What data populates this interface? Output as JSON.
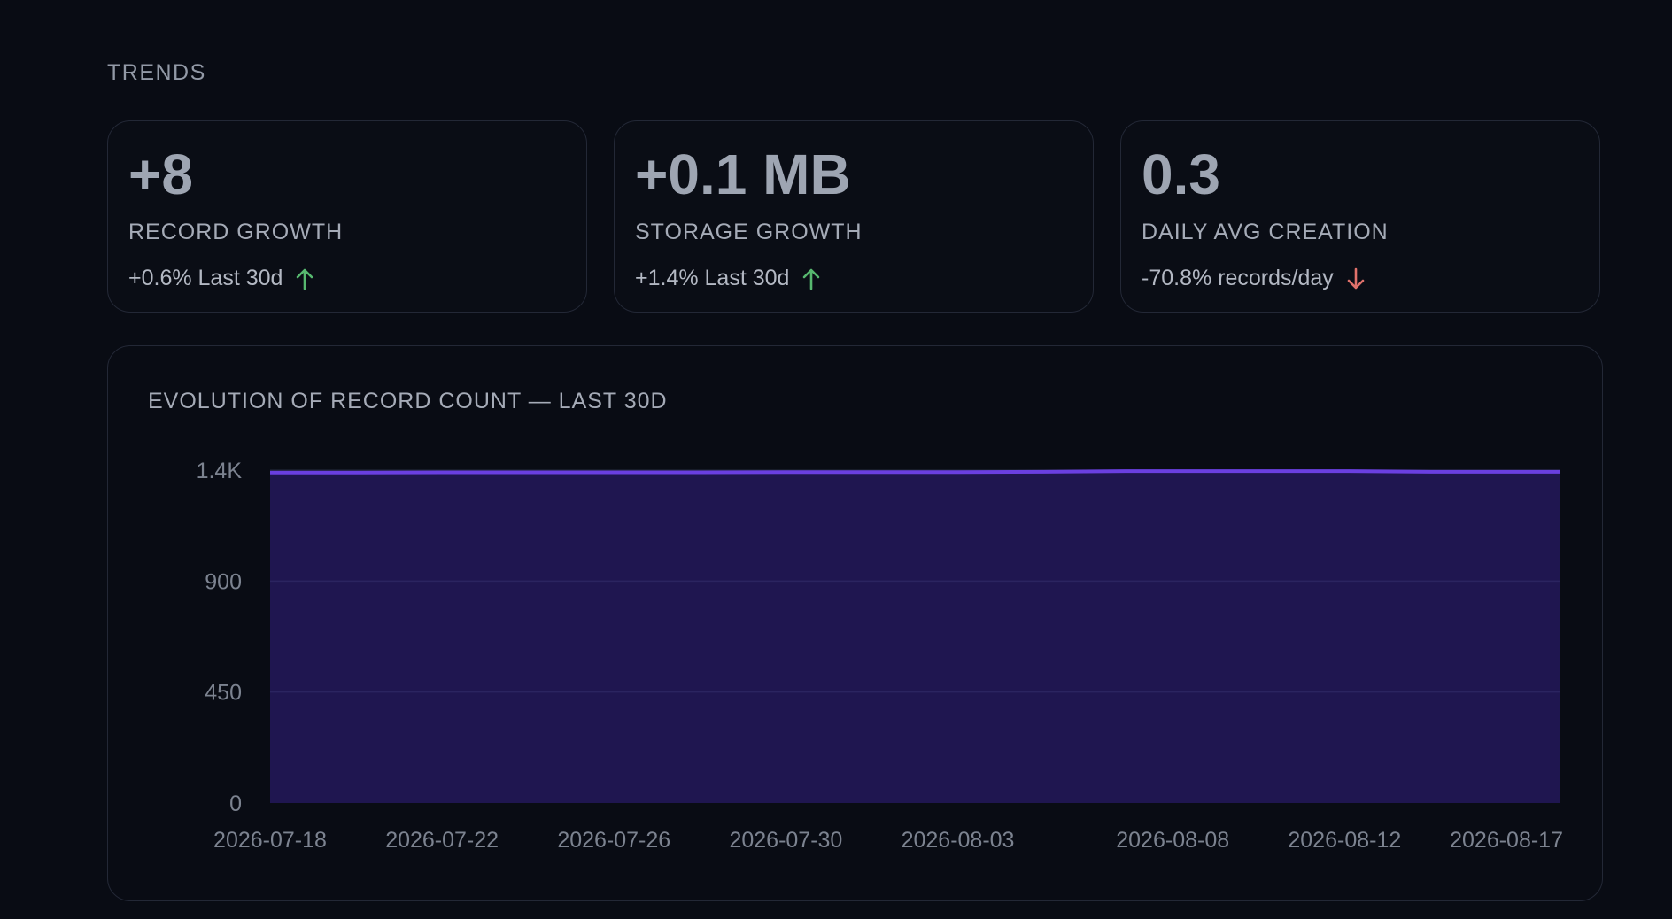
{
  "section_title": "TRENDS",
  "cards": [
    {
      "value": "+8",
      "label": "RECORD GROWTH",
      "delta": "+0.6% Last 30d",
      "trend": "up",
      "trend_color": "#57b86f"
    },
    {
      "value": "+0.1 MB",
      "label": "STORAGE GROWTH",
      "delta": "+1.4% Last 30d",
      "trend": "up",
      "trend_color": "#57b86f"
    },
    {
      "value": "0.3",
      "label": "DAILY AVG CREATION",
      "delta": "-70.8% records/day",
      "trend": "down",
      "trend_color": "#e0716b"
    }
  ],
  "chart": {
    "title": "EVOLUTION OF RECORD COUNT — LAST 30D"
  },
  "chart_data": {
    "type": "area",
    "title": "EVOLUTION OF RECORD COUNT — LAST 30D",
    "xlabel": "",
    "ylabel": "",
    "x_tick_labels": [
      "2026-07-18",
      "2026-07-22",
      "2026-07-26",
      "2026-07-30",
      "2026-08-03",
      "2026-08-08",
      "2026-08-12",
      "2026-08-17"
    ],
    "y_tick_values": [
      0,
      450,
      900,
      1350
    ],
    "y_tick_labels": [
      "0",
      "450",
      "900",
      "1.4K"
    ],
    "ylim": [
      0,
      1350
    ],
    "grid": "horizontal",
    "line_color": "#6a3fe0",
    "fill_color": "#1f1650",
    "x": [
      "2026-07-18",
      "2026-07-20",
      "2026-07-22",
      "2026-07-24",
      "2026-07-26",
      "2026-07-28",
      "2026-07-30",
      "2026-08-01",
      "2026-08-03",
      "2026-08-05",
      "2026-08-07",
      "2026-08-09",
      "2026-08-11",
      "2026-08-12",
      "2026-08-14",
      "2026-08-17"
    ],
    "series": [
      {
        "values": [
          1340,
          1340,
          1341,
          1341,
          1341,
          1341,
          1342,
          1342,
          1342,
          1343,
          1346,
          1346,
          1346,
          1346,
          1343,
          1343
        ]
      }
    ]
  }
}
